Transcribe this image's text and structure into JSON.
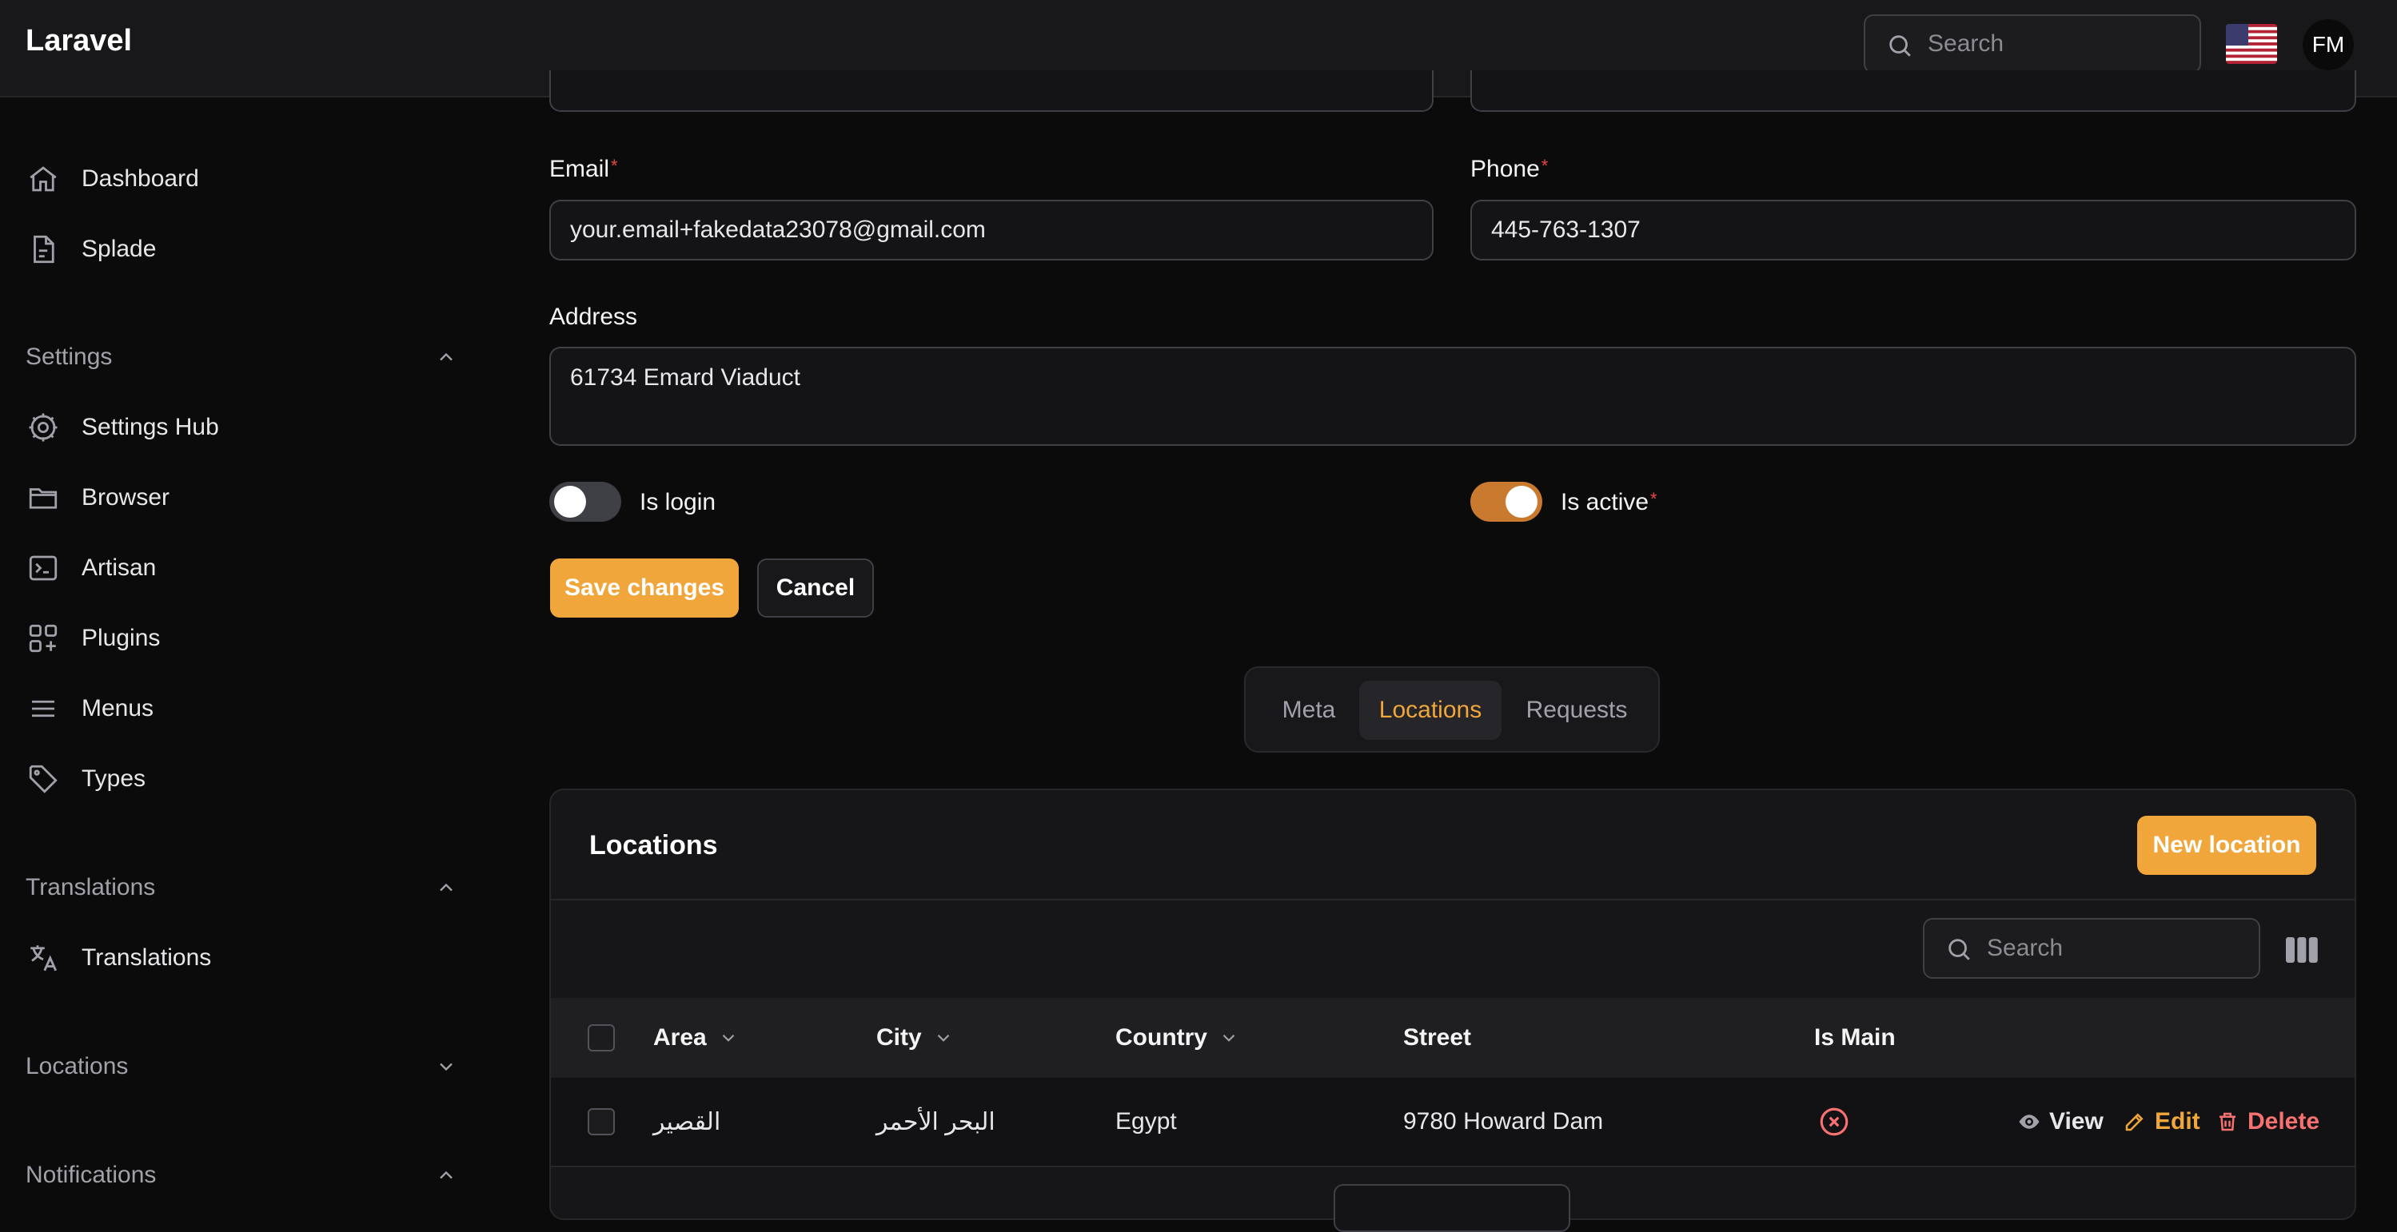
{
  "app": {
    "brand": "Laravel"
  },
  "header": {
    "search_placeholder": "Search",
    "avatar_initials": "FM",
    "flag_icon": "us-flag-icon"
  },
  "sidebar": {
    "items": [
      {
        "label": "Dashboard",
        "icon": "home-icon"
      },
      {
        "label": "Splade",
        "icon": "document-icon"
      }
    ],
    "groups": [
      {
        "label": "Settings",
        "expanded": true,
        "items": [
          {
            "label": "Settings Hub",
            "icon": "cog-icon"
          },
          {
            "label": "Browser",
            "icon": "folder-icon"
          },
          {
            "label": "Artisan",
            "icon": "terminal-icon"
          },
          {
            "label": "Plugins",
            "icon": "plugins-icon"
          },
          {
            "label": "Menus",
            "icon": "menu-icon"
          },
          {
            "label": "Types",
            "icon": "tag-icon"
          }
        ]
      },
      {
        "label": "Translations",
        "expanded": true,
        "items": [
          {
            "label": "Translations",
            "icon": "translate-icon"
          }
        ]
      },
      {
        "label": "Locations",
        "expanded": false,
        "items": []
      },
      {
        "label": "Notifications",
        "expanded": true,
        "items": []
      }
    ]
  },
  "form": {
    "email_label": "Email",
    "email_value": "your.email+fakedata23078@gmail.com",
    "phone_label": "Phone",
    "phone_value": "445-763-1307",
    "address_label": "Address",
    "address_value": "61734 Emard Viaduct",
    "required_mark": "*",
    "is_login_label": "Is login",
    "is_login": false,
    "is_active_label": "Is active",
    "is_active": true,
    "save_label": "Save changes",
    "cancel_label": "Cancel"
  },
  "tabs": [
    {
      "label": "Meta",
      "active": false
    },
    {
      "label": "Locations",
      "active": true
    },
    {
      "label": "Requests",
      "active": false
    }
  ],
  "locations": {
    "title": "Locations",
    "new_button": "New location",
    "search_placeholder": "Search",
    "columns": [
      "Area",
      "City",
      "Country",
      "Street",
      "Is Main"
    ],
    "rows": [
      {
        "area": "القصير",
        "city": "البحر الأحمر",
        "country": "Egypt",
        "street": "9780 Howard Dam",
        "is_main": false
      }
    ],
    "actions": {
      "view": "View",
      "edit": "Edit",
      "delete": "Delete"
    }
  },
  "colors": {
    "accent": "#f0a63a",
    "toggle_on": "#c97a2e",
    "danger": "#f87171",
    "background": "#0b0b0c"
  }
}
